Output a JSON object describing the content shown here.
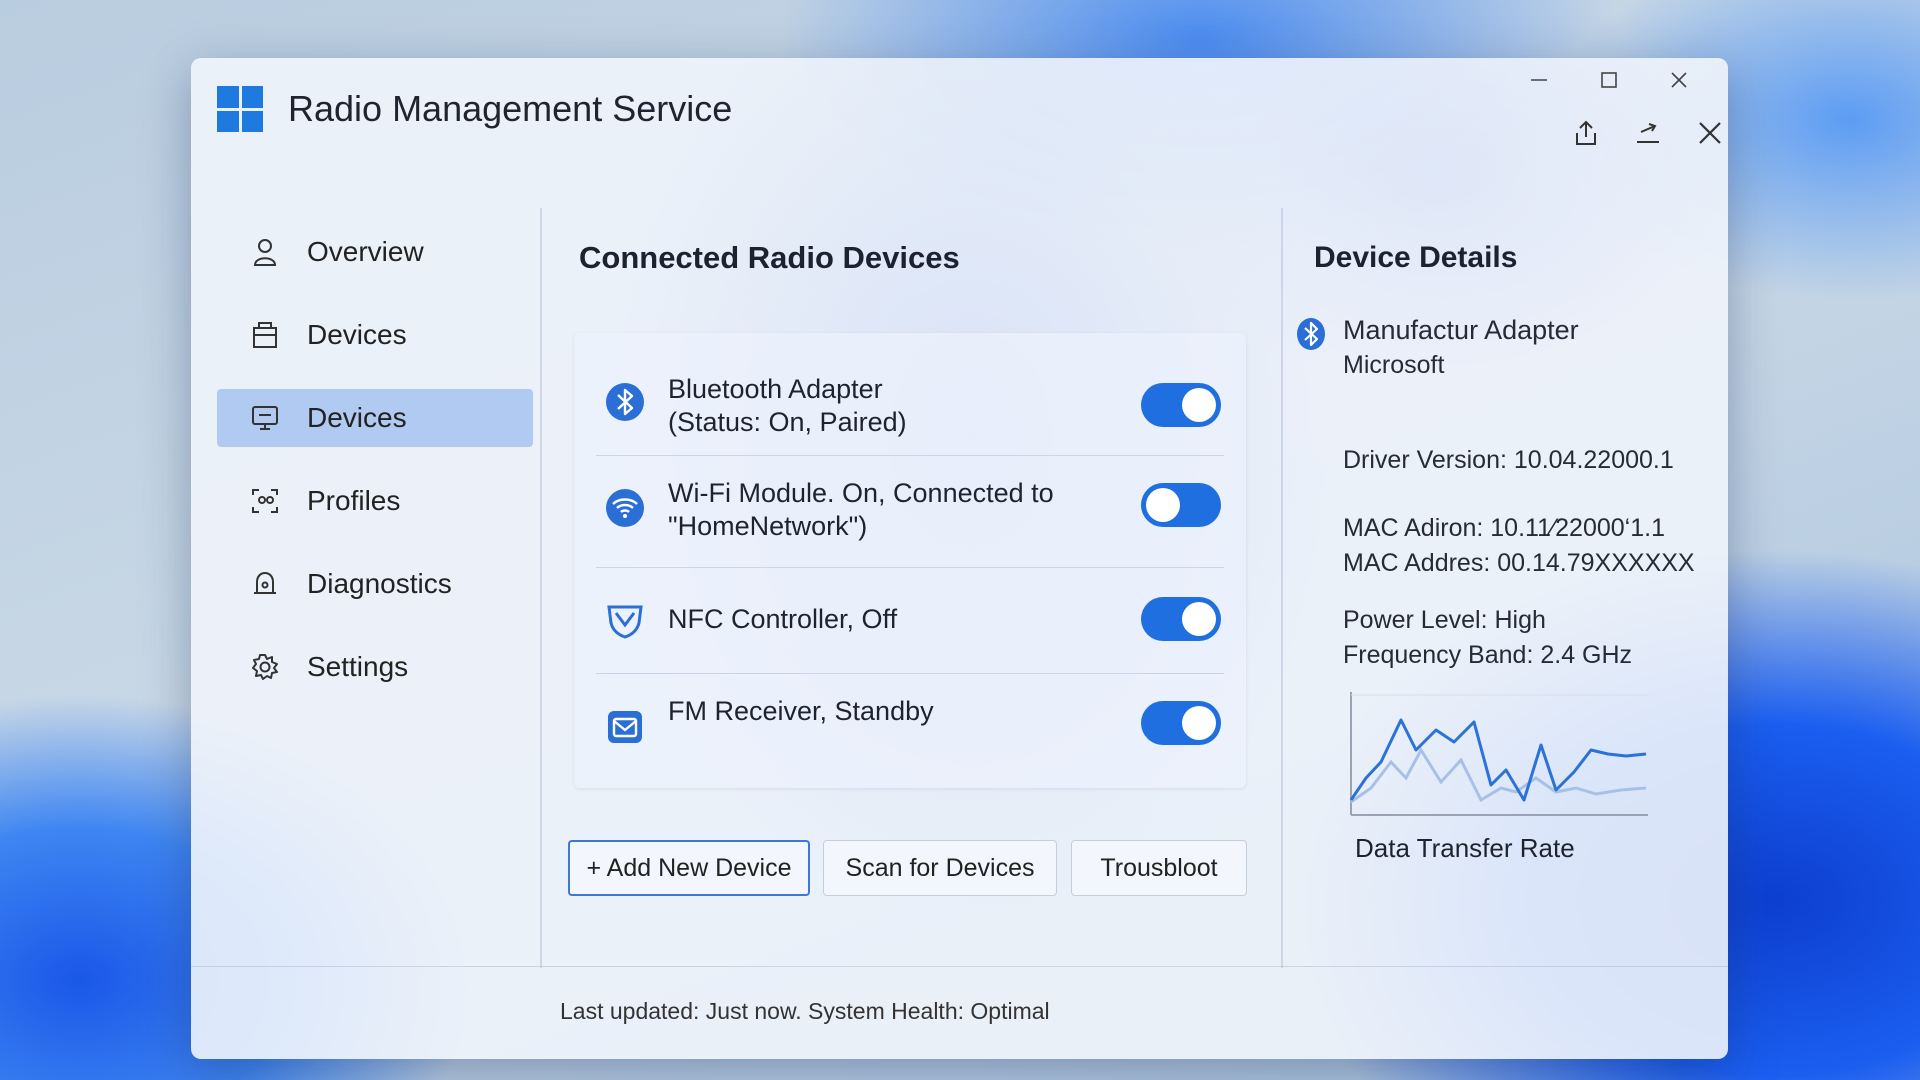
{
  "window": {
    "title": "Radio Management Service",
    "icons": {
      "logo": "windows-logo-icon",
      "minimize": "minimize-icon",
      "maximize": "maximize-icon",
      "close": "close-icon",
      "share": "share-icon",
      "export": "export-icon",
      "dismiss": "close-icon"
    }
  },
  "sidebar": {
    "items": [
      {
        "label": "Overview",
        "icon": "person-icon",
        "active": false
      },
      {
        "label": "Devices",
        "icon": "clipboard-icon",
        "active": false
      },
      {
        "label": "Devices",
        "icon": "monitor-icon",
        "active": true
      },
      {
        "label": "Profiles",
        "icon": "profile-scan-icon",
        "active": false
      },
      {
        "label": "Diagnostics",
        "icon": "bell-icon",
        "active": false
      },
      {
        "label": "Settings",
        "icon": "gear-icon",
        "active": false
      }
    ]
  },
  "main": {
    "title": "Connected Radio Devices",
    "devices": [
      {
        "line1": "Bluetooth Adapter",
        "line2": "(Status: On, Paired)",
        "icon": "bluetooth-icon",
        "toggle": "on"
      },
      {
        "line1": "Wi-Fi Module. On, Connected to",
        "line2": "\"HomeNetwork\")",
        "icon": "wifi-icon",
        "toggle": "off"
      },
      {
        "line1": "NFC Controller, Off",
        "line2": "",
        "icon": "nfc-icon",
        "toggle": "on"
      },
      {
        "line1": "FM Receiver, Standby",
        "line2": "",
        "icon": "radio-icon",
        "toggle": "on"
      }
    ],
    "buttons": {
      "add": "+ Add New Device",
      "scan": "Scan for Devices",
      "troubleshoot": "Trousbloot"
    }
  },
  "details": {
    "title": "Device Details",
    "icon": "bluetooth-icon",
    "manufacturer_label": "Manufactur Adapter",
    "manufacturer_value": "Microsoft",
    "driver_version": "Driver Version: 10.04.22000.1",
    "mac_adiron": "MAC Adiron: 10.11⁄22000‘1.1",
    "mac_address": "MAC Addres: 00.14.79XXXXXX",
    "power_level": "Power Level: High",
    "frequency_band": "Frequency Band: 2.4 GHz",
    "chart_label": "Data Transfer Rate"
  },
  "status": {
    "text": "Last updated: Just now. System Health: Optimal"
  },
  "colors": {
    "accent": "#1f6fe0",
    "active_nav": "#9db9ea",
    "chart_line": "#2a72d9",
    "chart_line_secondary": "#a9c0e6"
  }
}
